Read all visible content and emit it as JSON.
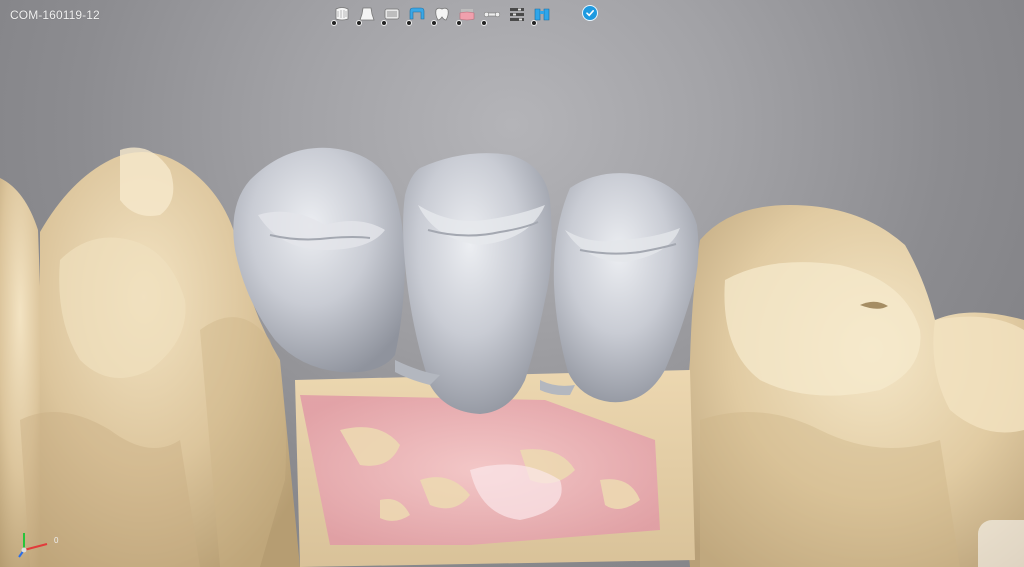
{
  "case": {
    "id": "COM-160119-12"
  },
  "toolbar": {
    "tools": [
      {
        "icon": "upper-jaw-scan-icon"
      },
      {
        "icon": "prep-die-icon"
      },
      {
        "icon": "gingiva-mask-icon"
      },
      {
        "icon": "bridge-framework-icon"
      },
      {
        "icon": "tooth-crown-icon"
      },
      {
        "icon": "gingiva-pink-icon"
      },
      {
        "icon": "connector-bone-icon"
      },
      {
        "icon": "layer-sliders-icon"
      },
      {
        "icon": "bridge-active-icon"
      }
    ],
    "confirm_icon": "checkmark-icon"
  },
  "axis": {
    "label": "0",
    "colors": {
      "x": "#e23b3b",
      "y": "#27c43b",
      "z": "#2b6ee8"
    }
  },
  "colors": {
    "background": "#9c9ca0",
    "stone": "#e3cfa6",
    "crown": "#c9ccd3",
    "gingiva": "#e6a2ad",
    "accent": "#1e9ae0"
  }
}
